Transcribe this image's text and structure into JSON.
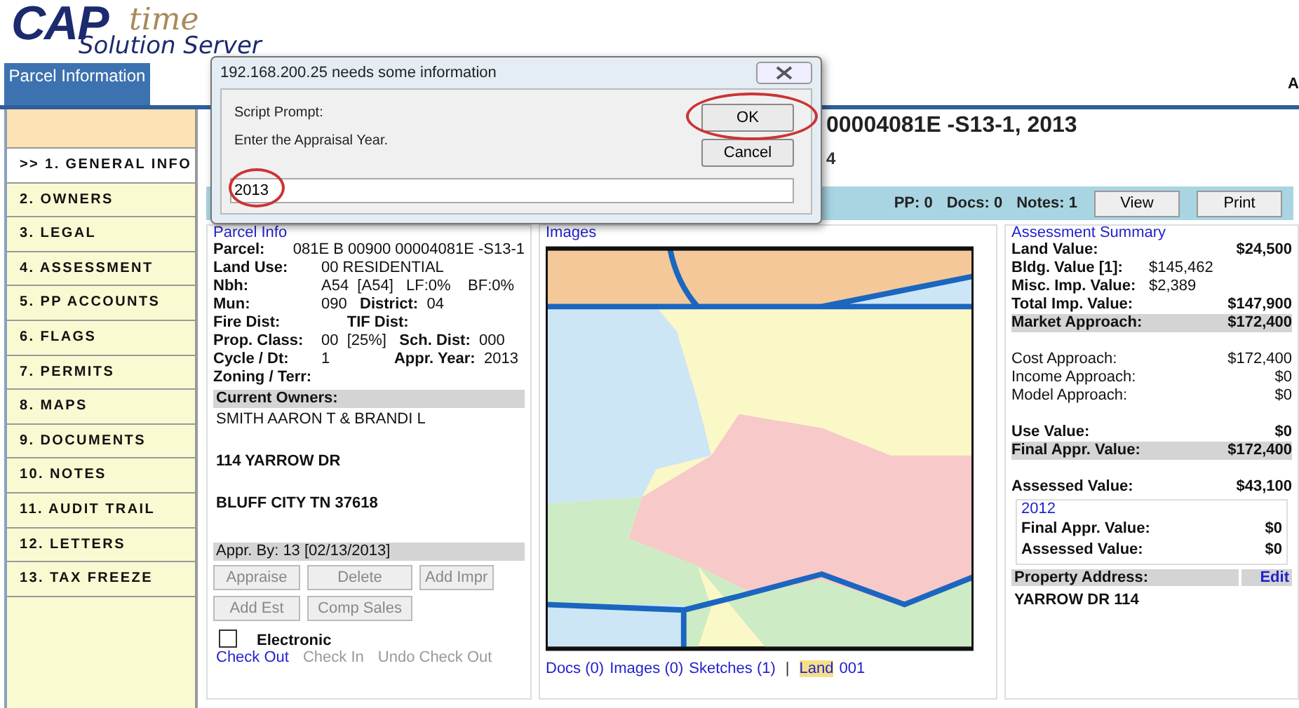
{
  "logo": {
    "main": "CAP",
    "script": "time",
    "sub": "Solution Server"
  },
  "header": {
    "tab": {
      "label": "Parcel Information",
      "selected": true
    },
    "edge_text": "A"
  },
  "sidebar": {
    "items": [
      {
        "label": ">> 1. GENERAL INFO",
        "selected": true
      },
      {
        "label": "2. OWNERS",
        "selected": false
      },
      {
        "label": "3. LEGAL",
        "selected": false
      },
      {
        "label": "4. ASSESSMENT",
        "selected": false
      },
      {
        "label": "5. PP ACCOUNTS",
        "selected": false
      },
      {
        "label": "6. FLAGS",
        "selected": false
      },
      {
        "label": "7. PERMITS",
        "selected": false
      },
      {
        "label": "8. MAPS",
        "selected": false
      },
      {
        "label": "9. DOCUMENTS",
        "selected": false
      },
      {
        "label": "10. NOTES",
        "selected": false
      },
      {
        "label": "11. AUDIT TRAIL",
        "selected": false
      },
      {
        "label": "12. LETTERS",
        "selected": false
      },
      {
        "label": "13. TAX FREEZE",
        "selected": false
      }
    ]
  },
  "record": {
    "title": "00004081E -S13-1, 2013",
    "subtitle": "4"
  },
  "toolbar": {
    "counts": [
      "PP: 0",
      "Docs: 0",
      "Notes: 1"
    ],
    "buttons": [
      "View",
      "Print"
    ]
  },
  "parcel_info": {
    "title": "Parcel Info",
    "fields": [
      {
        "label": "Parcel:",
        "value": "081E B 00900 00004081E -S13-1"
      },
      {
        "label": "Land Use:",
        "value": "00 RESIDENTIAL"
      },
      {
        "label": "Nbh:",
        "value": "A54  [A54]   LF:0%    BF:0%"
      },
      {
        "label": "Mun:",
        "value": "090   **District:**  04"
      },
      {
        "label": "Fire Dist:",
        "value": "      **TIF Dist:**"
      },
      {
        "label": "Prop. Class:",
        "value": "00  [25%]   **Sch. Dist:**  000"
      },
      {
        "label": "Cycle / Dt:",
        "value": "1               **Appr. Year:**  2013"
      },
      {
        "label": "Zoning / Terr:"
      }
    ],
    "owners_header": "Current Owners:",
    "owner_name": "SMITH AARON T & BRANDI L",
    "address_lines": [
      "114 YARROW DR",
      "BLUFF CITY TN 37618"
    ],
    "appraised_by": "Appr. By: 13 [02/13/2013]",
    "buttons": [
      {
        "label": "Appraise",
        "disabled": true
      },
      {
        "label": "Delete",
        "disabled": true
      },
      {
        "label": "Add Impr",
        "disabled": true
      },
      {
        "label": "Add Est",
        "disabled": true
      },
      {
        "label": "Comp Sales",
        "disabled": true
      }
    ],
    "checkbox": {
      "label": "Electronic",
      "checked": false
    },
    "links": [
      {
        "label": "Check Out",
        "disabled": false
      },
      {
        "label": "Check In",
        "disabled": true
      },
      {
        "label": "Undo Check Out",
        "disabled": true
      }
    ]
  },
  "images": {
    "title": "Images",
    "links": [
      {
        "label": "Docs (0)",
        "selected": false
      },
      {
        "label": "Images (0)",
        "selected": false
      },
      {
        "label": "Sketches (1)",
        "selected": false
      }
    ],
    "separator": "|",
    "tabs": [
      {
        "label": "Land",
        "selected": true
      },
      {
        "label": "001",
        "selected": false
      }
    ]
  },
  "assessment": {
    "title": "Assessment Summary",
    "groups": [
      {
        "rows": [
          {
            "kind": "bold",
            "label": "Land Value:",
            "value": "$24,500"
          },
          {
            "kind": "inline",
            "label": "Bldg. Value  [1]:",
            "value": "$145,462"
          },
          {
            "kind": "inline",
            "label": "Misc. Imp. Value:",
            "value": "$2,389"
          },
          {
            "kind": "bold",
            "label": "Total Imp. Value:",
            "value": "$147,900"
          },
          {
            "kind": "shaded",
            "label": "Market Approach:",
            "value": "$172,400"
          }
        ]
      },
      {
        "rows": [
          {
            "kind": "plain",
            "label": "Cost Approach:",
            "value": "$172,400"
          },
          {
            "kind": "plain",
            "label": "Income Approach:",
            "value": "$0"
          },
          {
            "kind": "plain",
            "label": "Model Approach:",
            "value": "$0"
          }
        ]
      },
      {
        "rows": [
          {
            "kind": "bold",
            "label": "Use Value:",
            "value": "$0"
          },
          {
            "kind": "shaded",
            "label": "Final Appr. Value:",
            "value": "$172,400"
          }
        ]
      },
      {
        "rows": [
          {
            "kind": "bold",
            "label": "Assessed Value:",
            "value": "$43,100"
          }
        ]
      }
    ],
    "prior": {
      "year": "2012",
      "rows": [
        {
          "label": "Final Appr. Value:",
          "value": "$0"
        },
        {
          "label": "Assessed Value:",
          "value": "$0"
        }
      ]
    },
    "address_header": "Property Address:",
    "edit_link": "Edit",
    "address": "YARROW DR 114"
  },
  "dialog": {
    "title": "192.168.200.25 needs some information",
    "prompt_label": "Script Prompt:",
    "message": "Enter the Appraisal Year.",
    "value": "2013",
    "buttons": [
      "OK",
      "Cancel"
    ]
  }
}
